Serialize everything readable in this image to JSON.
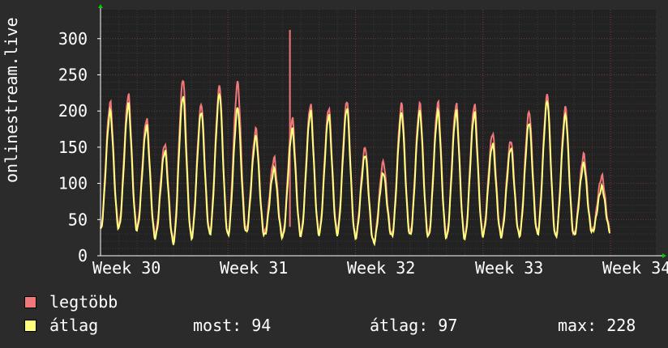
{
  "chart_data": {
    "type": "line",
    "ylabel": "onlinestream.live",
    "xlabel": "",
    "ylim": [
      0,
      340
    ],
    "yticks": [
      0,
      50,
      100,
      150,
      200,
      250,
      300
    ],
    "xticks": [
      "Week 30",
      "Week 31",
      "Week 32",
      "Week 33",
      "Week 34"
    ],
    "grid": true,
    "series": [
      {
        "name": "legtöbb",
        "color": "#f07878",
        "daily_peaks": [
          212,
          223,
          190,
          155,
          245,
          210,
          235,
          240,
          175,
          135,
          190,
          210,
          205,
          215,
          150,
          130,
          210,
          210,
          212,
          210,
          210,
          170,
          160,
          200,
          223,
          205,
          140,
          110
        ],
        "daily_troughs": [
          38,
          42,
          40,
          30,
          22,
          28,
          35,
          30,
          36,
          32,
          28,
          30,
          32,
          35,
          28,
          20,
          30,
          32,
          28,
          28,
          26,
          30,
          30,
          30,
          34,
          28,
          30,
          35
        ],
        "spike": {
          "x": 10.4,
          "y": 312
        }
      },
      {
        "name": "átlag",
        "color": "#ffff80",
        "daily_peaks": [
          200,
          210,
          180,
          145,
          222,
          200,
          225,
          205,
          165,
          120,
          175,
          200,
          195,
          205,
          140,
          115,
          198,
          200,
          200,
          200,
          198,
          155,
          150,
          185,
          215,
          195,
          128,
          95
        ],
        "daily_troughs": [
          35,
          38,
          36,
          25,
          18,
          25,
          30,
          28,
          32,
          28,
          26,
          28,
          30,
          30,
          25,
          18,
          27,
          28,
          26,
          25,
          24,
          28,
          27,
          28,
          30,
          26,
          28,
          33
        ]
      }
    ]
  },
  "legend": [
    {
      "label": "legtöbb",
      "color": "#f07878"
    },
    {
      "label": "átlag",
      "color": "#ffff80"
    }
  ],
  "stats": {
    "most": "most: 94",
    "atlag": "átlag: 97",
    "max": "max: 228"
  }
}
